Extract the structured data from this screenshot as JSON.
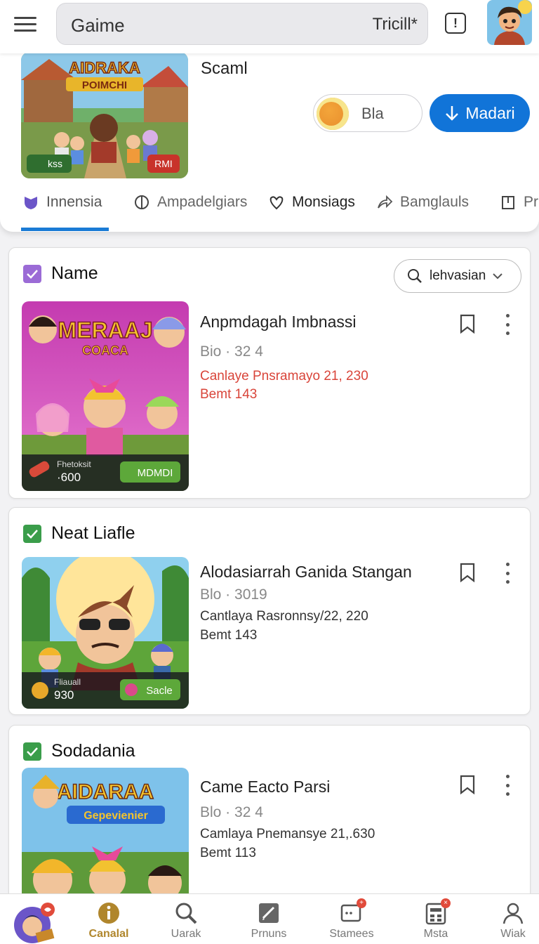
{
  "search": {
    "query": "Gaime",
    "trailing": "Tricill*"
  },
  "featured": {
    "title": "Scaml",
    "thumb_title": "AIDRAKA",
    "thumb_subtitle": "POIMCHI",
    "badge_left": "kss",
    "badge_right": "RMI",
    "toggle_label": "Bla",
    "download_label": "Madari"
  },
  "tabs": [
    {
      "label": "Innensia",
      "icon": "shield-icon"
    },
    {
      "label": "Ampadelgiars",
      "icon": "compass-icon"
    },
    {
      "label": "Monsiags",
      "icon": "heart-hand-icon"
    },
    {
      "label": "Bamglauls",
      "icon": "share-icon"
    },
    {
      "label": "Pr",
      "icon": "bookmark-box-icon"
    }
  ],
  "sections": [
    {
      "header": "Name",
      "check_color": "#9b6bd6",
      "filter_label": "lehvasian",
      "item": {
        "title": "Anpmdagah Imbnassi",
        "meta": "Bio · 32 4",
        "highlight": "Canlaye Pnsramayo 21, 230",
        "sub": "Bemt 143",
        "sub_color": "#d9453a",
        "thumb_title": "MERAAJ",
        "thumb_subtitle": "COACA",
        "badge_text_1": "Fhetoksit",
        "badge_text_2": "·600",
        "badge_right": "MDMDI"
      }
    },
    {
      "header": "Neat Liafle",
      "check_color": "#3a9d4a",
      "item": {
        "title": "Alodasiarrah Ganida Stangan",
        "meta": "Blo · 3019",
        "highlight": "Cantlaya Rasronnsy/22, 220",
        "sub": "Bemt 143",
        "sub_color": "#333333",
        "badge_text_1": "Fliauall",
        "badge_text_2": "930",
        "badge_right": "Sacle"
      }
    },
    {
      "header": "Sodadania",
      "check_color": "#3a9d4a",
      "item": {
        "title": "Came Eacto Parsi",
        "meta": "Blo · 32 4",
        "highlight": "Camlaya Pnemansye 21,.630",
        "sub": "Bemt 113",
        "sub_color": "#333333",
        "thumb_title": "AIDARAA",
        "thumb_subtitle": "Gepevienier"
      }
    }
  ],
  "bottom_nav": [
    {
      "label": "",
      "icon": "profile-avatar-icon"
    },
    {
      "label": "Canalal",
      "icon": "info-circle-icon"
    },
    {
      "label": "Uarak",
      "icon": "search-icon"
    },
    {
      "label": "Prnuns",
      "icon": "edit-icon"
    },
    {
      "label": "Stamees",
      "icon": "message-icon"
    },
    {
      "label": "Msta",
      "icon": "calculator-icon"
    },
    {
      "label": "Wiak",
      "icon": "user-icon"
    }
  ],
  "colors": {
    "accent": "#1174d8",
    "tab_indicator": "#1a7bd5",
    "active_nav": "#b0862c"
  }
}
